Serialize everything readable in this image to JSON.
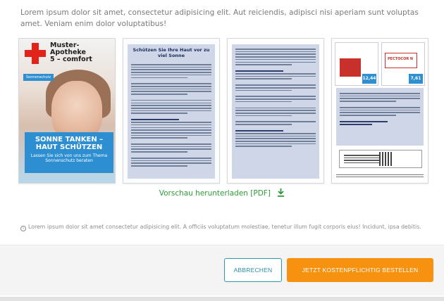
{
  "intro_text": "Lorem ipsum dolor sit amet, consectetur adipisicing elit. Aut reiciendis, adipisci nisi aperiam sunt voluptas amet. Veniam enim dolor voluptatibus!",
  "preview": {
    "page1": {
      "brand": "Muster-\nApotheke\n5 – comfort",
      "tag": "Sonnenschutz",
      "headline": "SONNE TANKEN – HAUT SCHÜTZEN",
      "subline": "Lassen Sie sich von uns zum Thema Sonnenschutz beraten"
    },
    "page2": {
      "title": "Schützen Sie Ihre Haut vor zu viel Sonne"
    },
    "page4": {
      "product1_price": "12,44",
      "product2_name": "PECTOCOR N",
      "product2_price": "7,61"
    }
  },
  "download_link": "Vorschau herunterladen [PDF]",
  "note": "Lorem ipsum dolor sit amet consectetur adipisicing elit. A officiis voluptatum molestiae, tenetur illum fugit corporis eius! Incidunt, ipsa debitis.",
  "buttons": {
    "cancel": "ABBRECHEN",
    "order": "JETZT KOSTENPFLICHTIG BESTELLEN"
  },
  "colors": {
    "accent_orange": "#f6920f",
    "accent_teal": "#2b9aa8",
    "link_green": "#2f9a39",
    "brand_blue": "#2d8fd2",
    "brand_red": "#e2231a"
  },
  "icons": {
    "download": "download-icon",
    "info": "info-icon"
  }
}
